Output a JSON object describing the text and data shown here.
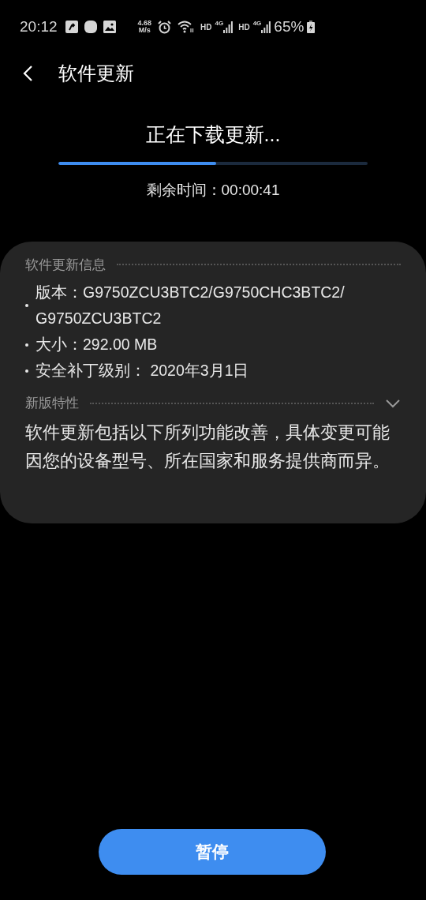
{
  "status_bar": {
    "time": "20:12",
    "net_speed": {
      "value": "4.68",
      "unit": "M/s"
    },
    "signals": [
      {
        "hd": "HD",
        "net": "4G"
      },
      {
        "hd": "HD",
        "net": "4G"
      }
    ],
    "battery": "65%"
  },
  "header": {
    "title": "软件更新"
  },
  "download": {
    "title": "正在下载更新...",
    "level": 0.51,
    "remaining": "剩余时间：00:00:41"
  },
  "info": {
    "heading": "软件更新信息",
    "items": [
      "版本：G9750ZCU3BTC2/G9750CHC3BTC2/G9750ZCU3BTC2",
      "大小：292.00 MB",
      "安全补丁级别： 2020年3月1日"
    ]
  },
  "features": {
    "heading": "新版特性",
    "expanded": false,
    "description": "软件更新包括以下所列功能改善，具体变更可能因您的设备型号、所在国家和服务提供商而异。"
  },
  "pause_button": "暂停"
}
